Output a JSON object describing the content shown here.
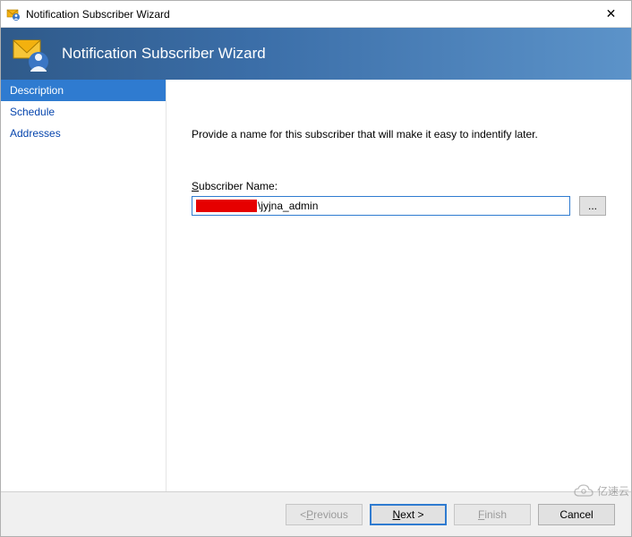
{
  "window": {
    "title": "Notification Subscriber Wizard"
  },
  "banner": {
    "title": "Notification Subscriber Wizard"
  },
  "sidebar": {
    "items": [
      {
        "label": "Description",
        "selected": true
      },
      {
        "label": "Schedule",
        "selected": false
      },
      {
        "label": "Addresses",
        "selected": false
      }
    ]
  },
  "content": {
    "instruction": "Provide a name for this subscriber that will make it easy to indentify later.",
    "field_label_prefix": "S",
    "field_label_rest": "ubscriber Name:",
    "input_value_visible": "\\jyjna_admin",
    "browse_label": "..."
  },
  "footer": {
    "previous_prefix": "< ",
    "previous_u": "P",
    "previous_rest": "revious",
    "next_u": "N",
    "next_rest": "ext >",
    "finish_u": "F",
    "finish_rest": "inish",
    "cancel": "Cancel"
  },
  "watermark": {
    "text": "亿速云"
  }
}
